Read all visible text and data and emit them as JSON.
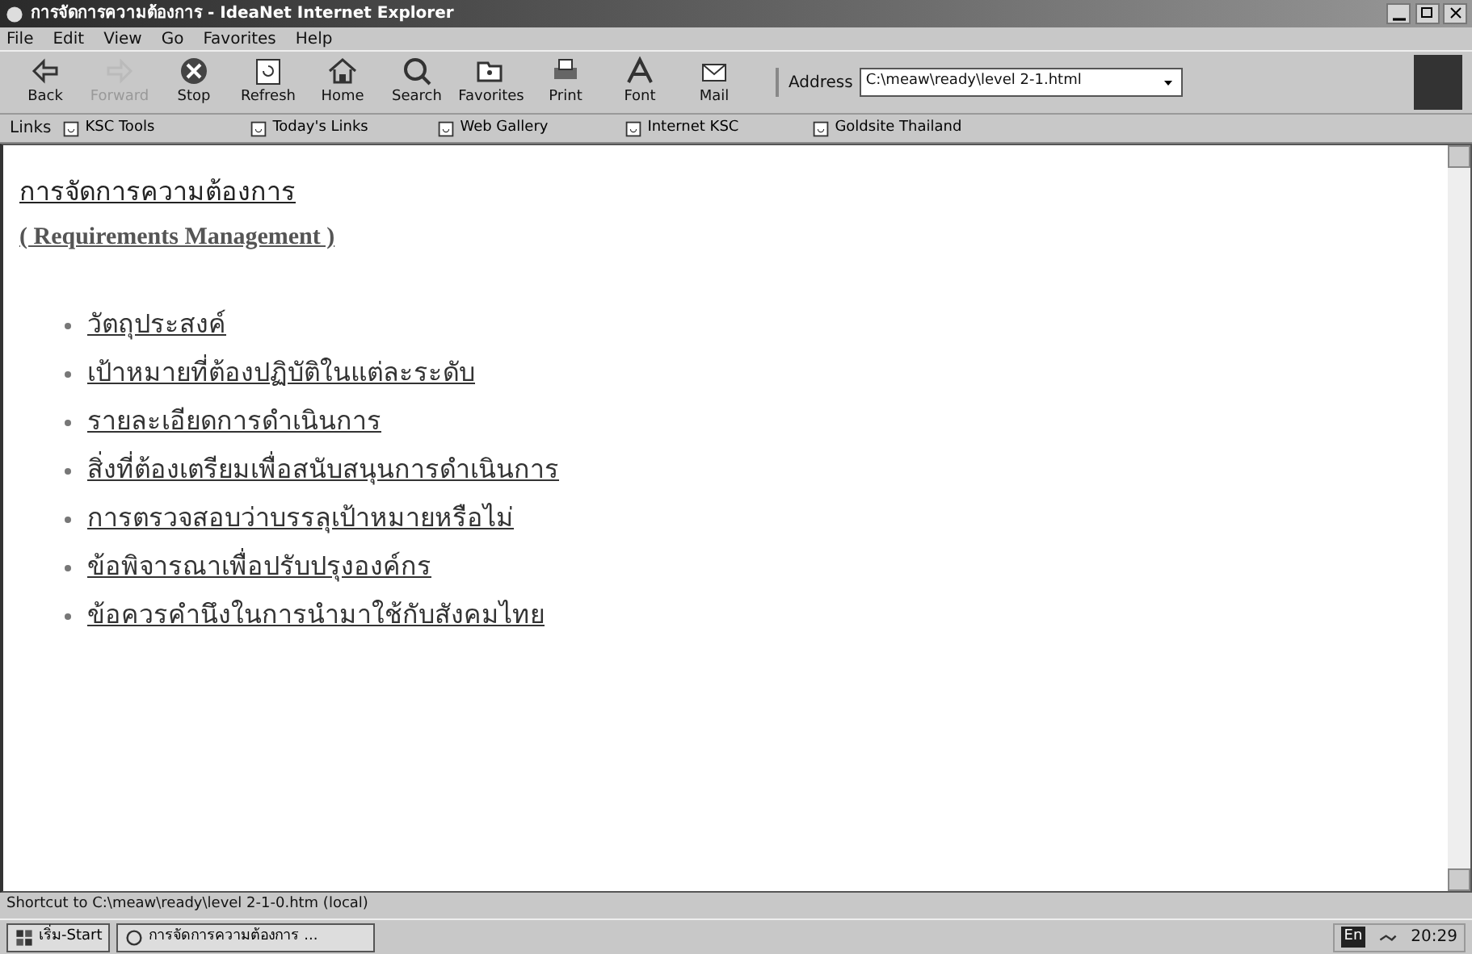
{
  "window": {
    "title": "การจัดการความต้องการ - IdeaNet Internet Explorer"
  },
  "menu": [
    "File",
    "Edit",
    "View",
    "Go",
    "Favorites",
    "Help"
  ],
  "toolbar": [
    {
      "label": "Back",
      "kind": "back",
      "disabled": false
    },
    {
      "label": "Forward",
      "kind": "forward",
      "disabled": true
    },
    {
      "label": "Stop",
      "kind": "stop",
      "disabled": false
    },
    {
      "label": "Refresh",
      "kind": "refresh",
      "disabled": false
    },
    {
      "label": "Home",
      "kind": "home",
      "disabled": false
    },
    {
      "label": "Search",
      "kind": "search",
      "disabled": false
    },
    {
      "label": "Favorites",
      "kind": "favorites",
      "disabled": false
    },
    {
      "label": "Print",
      "kind": "print",
      "disabled": false
    },
    {
      "label": "Font",
      "kind": "font",
      "disabled": false
    },
    {
      "label": "Mail",
      "kind": "mail",
      "disabled": false
    }
  ],
  "address": {
    "label": "Address",
    "value": "C:\\meaw\\ready\\level 2-1.html"
  },
  "links": {
    "label": "Links",
    "items": [
      "KSC Tools",
      "Today's Links",
      "Web Gallery",
      "Internet KSC",
      "Goldsite Thailand"
    ]
  },
  "page": {
    "heading": "การจัดการความต้องการ",
    "subheading": "( Requirements Management )",
    "items": [
      "วัตถุประสงค์",
      "เป้าหมายที่ต้องปฏิบัติในแต่ละระดับ",
      "รายละเอียดการดำเนินการ",
      "สิ่งที่ต้องเตรียมเพื่อสนับสนุนการดำเนินการ",
      "การตรวจสอบว่าบรรลุเป้าหมายหรือไม่",
      "ข้อพิจารณาเพื่อปรับปรุงองค์กร",
      "ข้อควรคำนึงในการนำมาใช้กับสังคมไทย"
    ]
  },
  "status_bar": {
    "text": "Shortcut to C:\\meaw\\ready\\level 2-1-0.htm (local)"
  },
  "taskbar": {
    "start": "เริ่ม-Start",
    "tasks": [
      "การจัดการความต้องการ ..."
    ],
    "language": "En",
    "clock": "20:29"
  }
}
